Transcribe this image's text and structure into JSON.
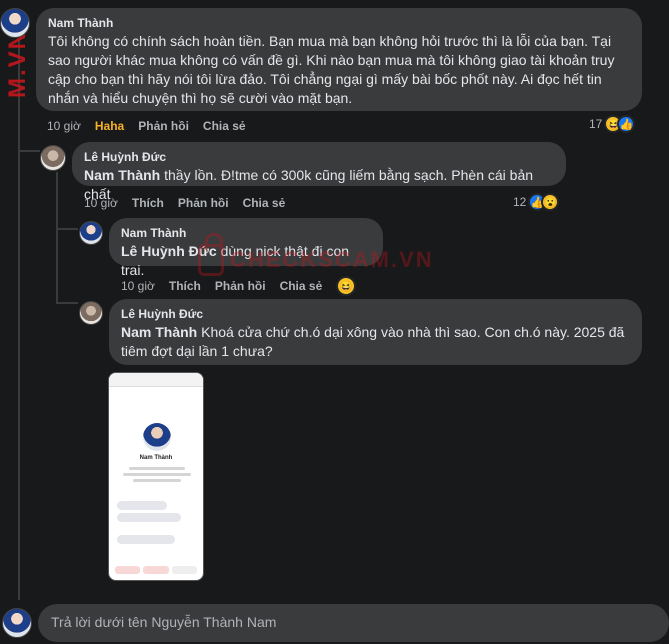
{
  "side_watermark": "M.VN",
  "watermark": {
    "text": "CHECKSCAM.VN"
  },
  "comments": [
    {
      "author": "Nam Thành",
      "text": "Tôi không có chính sách hoàn tiền. Bạn mua mà bạn không hỏi trước thì là lỗi của bạn. Tại sao người khác mua không có vấn đề gì. Khi nào bạn mua mà tôi không giao tài khoản truy cập cho bạn thì hãy nói tôi lừa đảo. Tôi chẳng ngại gì mấy bài bốc phốt này. Ai đọc hết tin nhắn và hiểu chuyện thì họ sẽ cười vào mặt bạn.",
      "time": "10 giờ",
      "reaction_label": "Haha",
      "reply": "Phản hồi",
      "share": "Chia sẻ",
      "reaction_count": "17",
      "reaction_icons": [
        "haha-icon",
        "like-icon"
      ]
    },
    {
      "author": "Lê Huỳnh Đức",
      "mention": "Nam Thành",
      "text": " thầy lồn. Đ!tme có 300k cũng liếm bằng sạch. Phèn cái bản chất",
      "time": "10 giờ",
      "like": "Thích",
      "reply": "Phản hồi",
      "share": "Chia sẻ",
      "reaction_count": "12",
      "reaction_icons": [
        "like-icon",
        "wow-icon"
      ]
    },
    {
      "author": "Nam Thành",
      "mention": "Lê Huỳnh Đức",
      "text": " dùng nick thật đi con trai.",
      "time": "10 giờ",
      "like": "Thích",
      "reply": "Phản hồi",
      "share": "Chia sẻ",
      "reaction_icons": [
        "haha-icon"
      ]
    },
    {
      "author": "Lê Huỳnh Đức",
      "mention": "Nam Thành",
      "text": " Khoá cửa chứ ch.ó dại xông vào nhà thì sao. Con ch.ó này. 2025 đã tiêm đợt dại lần 1 chưa?",
      "attachment": {
        "profile_name": "Nam Thành"
      }
    }
  ],
  "reply_box": {
    "placeholder": "Trả lời dưới tên Nguyễn Thành Nam"
  },
  "colors": {
    "background": "#18191a",
    "bubble": "#3a3b3c",
    "haha": "#f7b125",
    "like": "#1877f2"
  }
}
